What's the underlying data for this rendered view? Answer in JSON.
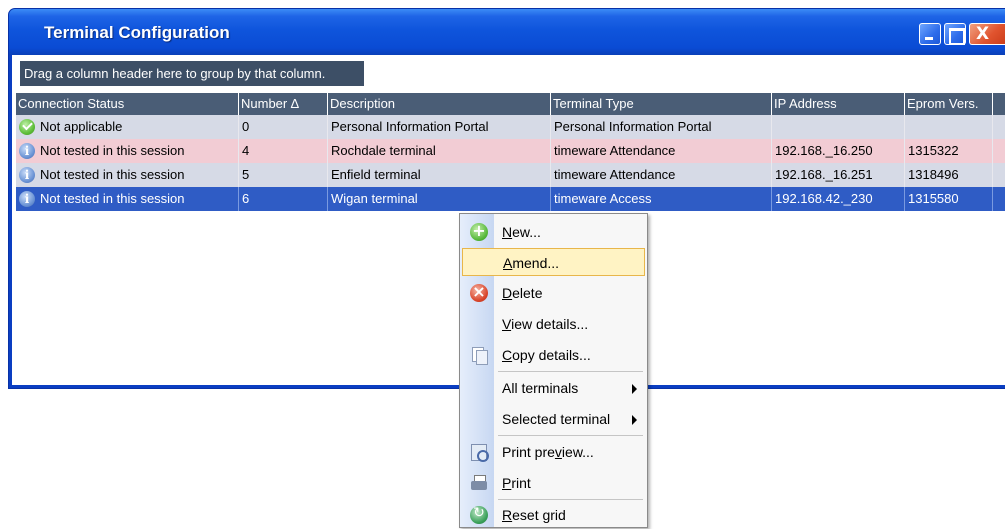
{
  "window": {
    "title": "Terminal Configuration"
  },
  "titlebar_buttons": {
    "minimize_icon": "minimize-icon",
    "maximize_icon": "maximize-icon",
    "close_glyph": "X"
  },
  "group_panel": {
    "hint": "Drag a column header here to group by that column."
  },
  "grid": {
    "columns": [
      "Connection Status",
      "Number ∆",
      "Description",
      "Terminal Type",
      "IP Address",
      "Eprom Vers."
    ],
    "rows": [
      {
        "status_icon": "check-ok-icon",
        "status": "Not applicable",
        "number": "0",
        "description": "Personal Information Portal",
        "terminal_type": "Personal Information Portal",
        "ip": "",
        "eprom": ""
      },
      {
        "status_icon": "info-icon",
        "status": "Not tested in this session",
        "number": "4",
        "description": "Rochdale terminal",
        "terminal_type": "timeware Attendance",
        "ip": "192.168._16.250",
        "eprom": "1315322"
      },
      {
        "status_icon": "info-icon",
        "status": "Not tested in this session",
        "number": "5",
        "description": "Enfield terminal",
        "terminal_type": "timeware Attendance",
        "ip": "192.168._16.251",
        "eprom": "1318496"
      },
      {
        "status_icon": "info-icon",
        "status": "Not tested in this session",
        "number": "6",
        "description": "Wigan terminal",
        "terminal_type": "timeware Access",
        "ip": "192.168.42._230",
        "eprom": "1315580"
      }
    ],
    "selected_row": 3
  },
  "context_menu": {
    "items": [
      {
        "label_mnemonic": "N",
        "label_rest": "ew...",
        "icon": "new-icon"
      },
      {
        "label_mnemonic": "A",
        "label_rest": "mend...",
        "icon": "",
        "highlighted": true
      },
      {
        "label_mnemonic": "D",
        "label_rest": "elete",
        "icon": "delete-icon"
      },
      {
        "label_mnemonic": "V",
        "label_rest": "iew details...",
        "icon": ""
      },
      {
        "label_mnemonic": "C",
        "label_rest": "opy details...",
        "icon": "copy-icon"
      },
      {
        "label": "All terminals",
        "submenu": true
      },
      {
        "label": "Selected terminal",
        "submenu": true
      },
      {
        "label_pre": "Print pre",
        "label_mnemonic": "v",
        "label_rest": "iew...",
        "icon": "print-preview-icon"
      },
      {
        "label_mnemonic": "P",
        "label_rest": "rint",
        "icon": "print-icon"
      },
      {
        "label_mnemonic": "R",
        "label_rest": "eset grid",
        "icon": "reset-grid-icon"
      }
    ]
  }
}
